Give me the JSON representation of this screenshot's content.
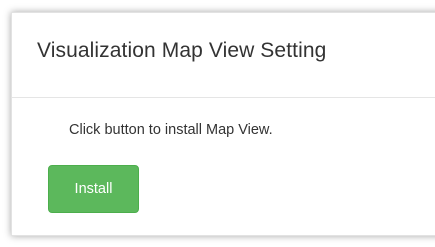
{
  "panel": {
    "title": "Visualization Map View Setting",
    "description": "Click button to install Map View.",
    "install_label": "Install"
  },
  "colors": {
    "install_button_bg": "#5cb85c",
    "install_button_border": "#4cae4c",
    "title_text": "#333333",
    "divider": "#e5e5e5"
  }
}
